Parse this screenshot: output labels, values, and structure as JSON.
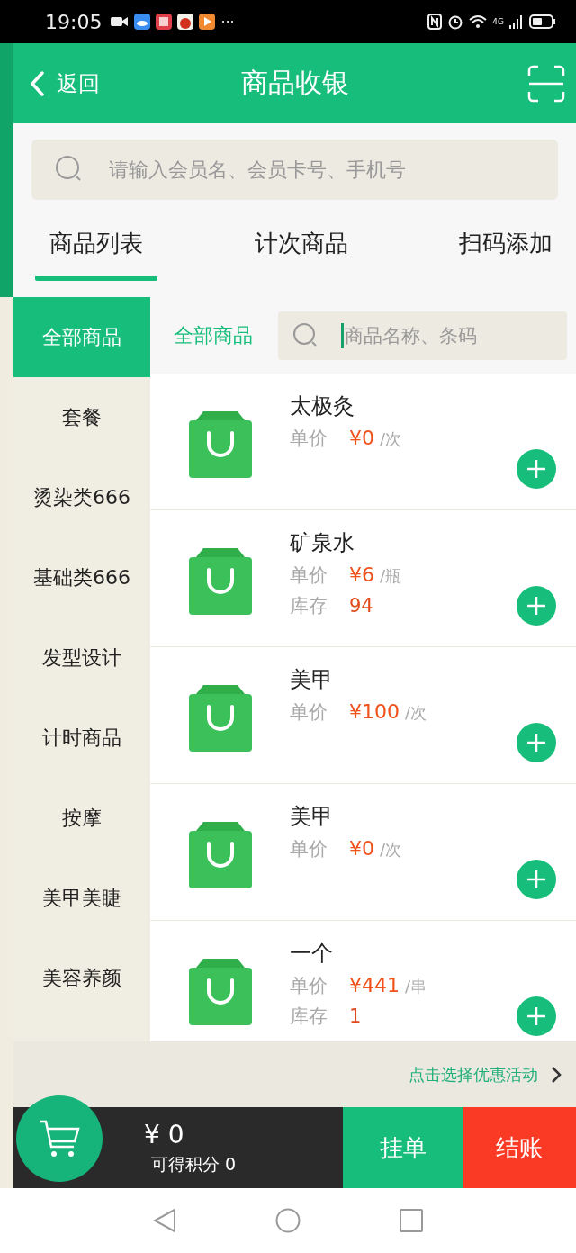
{
  "status_bar": {
    "time": "19:05",
    "more": "···",
    "network": "4G"
  },
  "header": {
    "back_label": "返回",
    "title": "商品收银"
  },
  "member_search": {
    "placeholder": "请输入会员名、会员卡号、手机号"
  },
  "tabs": [
    {
      "label": "商品列表",
      "selected": true
    },
    {
      "label": "计次商品",
      "selected": false
    },
    {
      "label": "扫码添加",
      "selected": false
    }
  ],
  "categories": [
    {
      "label": "全部商品",
      "selected": true
    },
    {
      "label": "套餐",
      "selected": false
    },
    {
      "label": "烫染类666",
      "selected": false
    },
    {
      "label": "基础类666",
      "selected": false
    },
    {
      "label": "发型设计",
      "selected": false
    },
    {
      "label": "计时商品",
      "selected": false
    },
    {
      "label": "按摩",
      "selected": false
    },
    {
      "label": "美甲美睫",
      "selected": false
    },
    {
      "label": "美容养颜",
      "selected": false
    }
  ],
  "product_list": {
    "category_title": "全部商品",
    "search_placeholder": "商品名称、条码"
  },
  "products": [
    {
      "name": "太极灸",
      "price_label": "单价",
      "price": "¥0",
      "unit": "/次"
    },
    {
      "name": "矿泉水",
      "price_label": "单价",
      "price": "¥6",
      "unit": "/瓶",
      "stock_label": "库存",
      "stock": "94"
    },
    {
      "name": "美甲",
      "price_label": "单价",
      "price": "¥100",
      "unit": "/次"
    },
    {
      "name": "美甲",
      "price_label": "单价",
      "price": "¥0",
      "unit": "/次"
    },
    {
      "name": "一个",
      "price_label": "单价",
      "price": "¥441",
      "unit": "/串",
      "stock_label": "库存",
      "stock": "1"
    }
  ],
  "promotion_link": "点击选择优惠活动",
  "checkout_bar": {
    "total": "¥ 0",
    "points": "可得积分  0",
    "hold_button": "挂单",
    "checkout_button": "结账"
  }
}
